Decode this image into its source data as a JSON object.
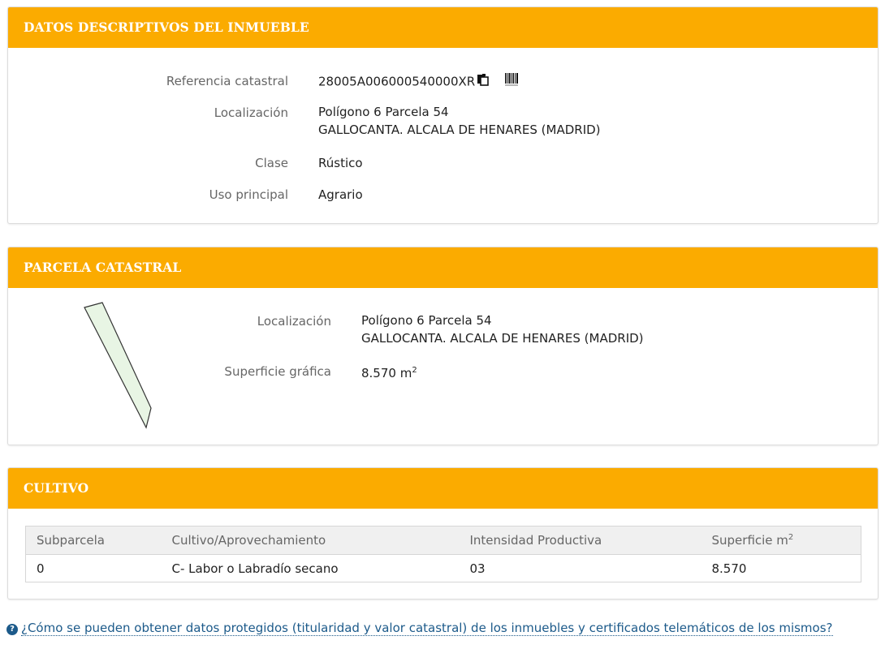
{
  "descriptive": {
    "title": "DATOS DESCRIPTIVOS DEL INMUEBLE",
    "ref_label": "Referencia catastral",
    "ref_value": "28005A006000540000XR",
    "loc_label": "Localización",
    "loc_line1": "Polígono 6 Parcela 54",
    "loc_line2": "GALLOCANTA. ALCALA DE HENARES (MADRID)",
    "class_label": "Clase",
    "class_value": "Rústico",
    "use_label": "Uso principal",
    "use_value": "Agrario"
  },
  "parcel": {
    "title": "PARCELA CATASTRAL",
    "loc_label": "Localización",
    "loc_line1": "Polígono 6 Parcela 54",
    "loc_line2": "GALLOCANTA. ALCALA DE HENARES (MADRID)",
    "area_label": "Superficie gráfica",
    "area_value": "8.570 m",
    "area_sup": "2",
    "shape_fill": "#e8f5e4",
    "shape_stroke": "#333333"
  },
  "crop": {
    "title": "CULTIVO",
    "headers": [
      "Subparcela",
      "Cultivo/Aprovechamiento",
      "Intensidad Productiva",
      "Superficie m"
    ],
    "header_sup": "2",
    "rows": [
      [
        "0",
        "C- Labor o Labradío secano",
        "03",
        "8.570"
      ]
    ]
  },
  "help_link": "¿Cómo se pueden obtener datos protegidos (titularidad y valor catastral) de los inmuebles y certificados telemáticos de los mismos?",
  "colors": {
    "header_bg": "#fbab00",
    "link": "#1c5a8a"
  }
}
